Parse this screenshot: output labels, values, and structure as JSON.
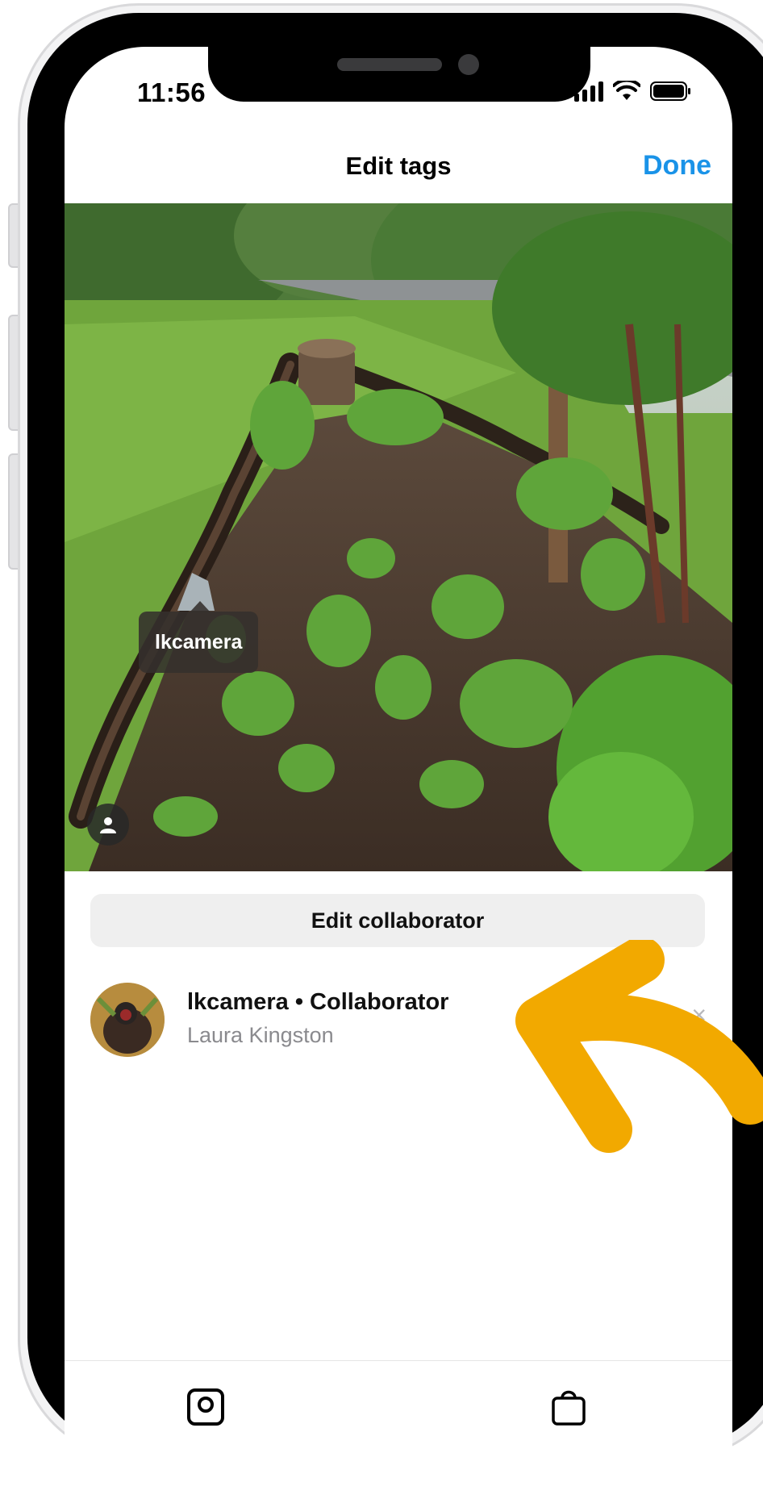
{
  "status_bar": {
    "time": "11:56"
  },
  "nav": {
    "title": "Edit tags",
    "done_label": "Done"
  },
  "photo": {
    "tag_username": "lkcamera"
  },
  "edit_collaborator_label": "Edit collaborator",
  "collaborator": {
    "title": "lkcamera • Collaborator",
    "full_name": "Laura Kingston",
    "remove_icon": "×"
  },
  "bottom_tabs": [
    {
      "icon": "tag-people-icon"
    },
    {
      "icon": "tag-products-icon"
    }
  ],
  "colors": {
    "done_blue": "#1a93e8",
    "annotation_arrow": "#f2a900"
  }
}
